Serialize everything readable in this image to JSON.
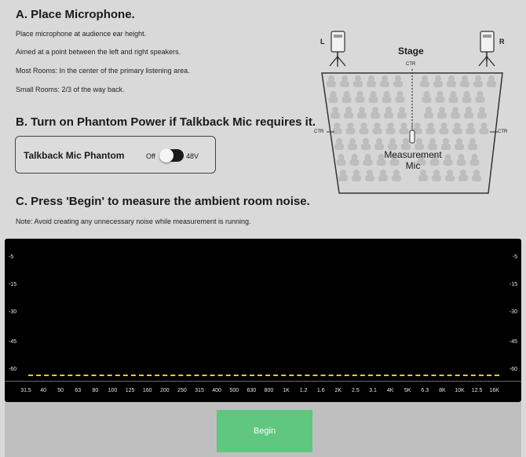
{
  "sectionA": {
    "heading": "A. Place Microphone.",
    "lines": [
      "Place microphone at audience ear height.",
      "Aimed at a point between the left and right speakers.",
      "Most Rooms: In the center of the primary listening area.",
      "Small Rooms: 2/3 of the way back."
    ]
  },
  "sectionB": {
    "heading": "B. Turn on Phantom Power if Talkback Mic requires it.",
    "phantom_label": "Talkback Mic Phantom",
    "toggle_off_label": "Off",
    "toggle_on_label": "48V",
    "toggle_state": "48V"
  },
  "sectionC": {
    "heading": "C. Press 'Begin' to measure the ambient room noise.",
    "note": "Note: Avoid creating any unnecessary noise while measurement is running."
  },
  "diagram": {
    "left_speaker": "L",
    "right_speaker": "R",
    "stage_label": "Stage",
    "ctr_top": "CTR",
    "ctr_left": "CTR",
    "ctr_right": "CTR",
    "mic_label_line1": "Measurement",
    "mic_label_line2": "Mic"
  },
  "meter": {
    "y_labels": [
      "-5",
      "-15",
      "-30",
      "-45",
      "-60"
    ],
    "x_labels": [
      "31.5",
      "40",
      "50",
      "63",
      "80",
      "100",
      "125",
      "160",
      "200",
      "250",
      "315",
      "400",
      "500",
      "630",
      "800",
      "1K",
      "1.2",
      "1.6",
      "2K",
      "2.5",
      "3.1",
      "4K",
      "5K",
      "6.3",
      "8K",
      "10K",
      "12.5",
      "16K"
    ],
    "threshold_color": "#e6d200"
  },
  "controls": {
    "begin_label": "Begin"
  }
}
